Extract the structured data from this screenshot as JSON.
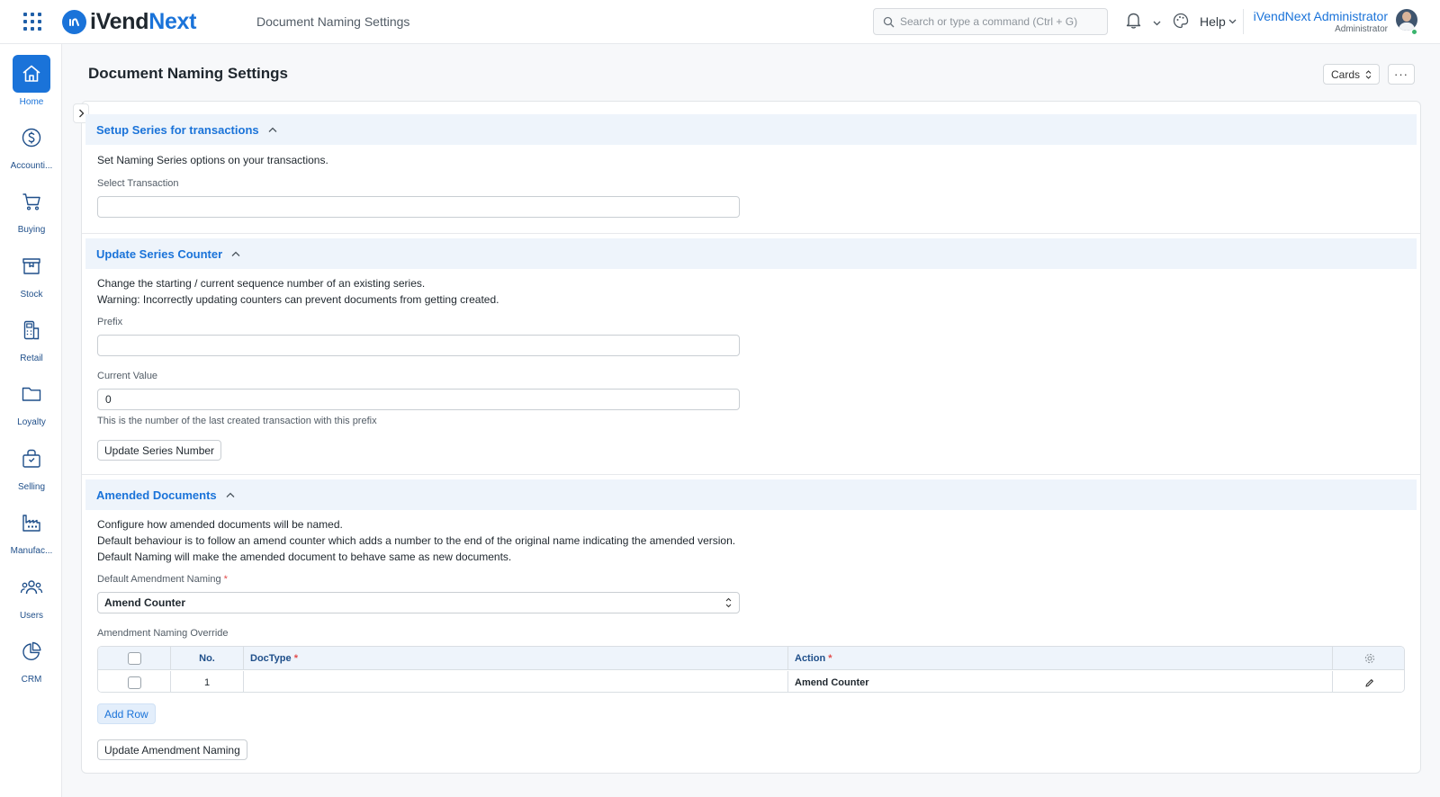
{
  "navbar": {
    "logo_part1": "iVend",
    "logo_part2": "Next",
    "page_name": "Document Naming Settings",
    "search_placeholder": "Search or type a command (Ctrl + G)",
    "help_label": "Help",
    "user_full_name": "iVendNext Administrator",
    "user_role": "Administrator"
  },
  "sidebar": {
    "items": [
      {
        "label": "Home",
        "icon": "home-icon",
        "active": true
      },
      {
        "label": "Accounti...",
        "icon": "dollar-icon"
      },
      {
        "label": "Buying",
        "icon": "cart-icon"
      },
      {
        "label": "Stock",
        "icon": "box-icon"
      },
      {
        "label": "Retail",
        "icon": "pos-icon"
      },
      {
        "label": "Loyalty",
        "icon": "folder-icon"
      },
      {
        "label": "Selling",
        "icon": "bag-icon"
      },
      {
        "label": "Manufac...",
        "icon": "factory-icon"
      },
      {
        "label": "Users",
        "icon": "users-icon"
      },
      {
        "label": "CRM",
        "icon": "chart-pie-icon"
      }
    ]
  },
  "page": {
    "title": "Document Naming Settings",
    "view_button": "Cards",
    "more_button": "···"
  },
  "setup_series": {
    "heading": "Setup Series for transactions",
    "description": "Set Naming Series options on your transactions.",
    "select_transaction_label": "Select Transaction",
    "select_transaction_value": ""
  },
  "update_counter": {
    "heading": "Update Series Counter",
    "description_line1": "Change the starting / current sequence number of an existing series.",
    "description_line2": "Warning: Incorrectly updating counters can prevent documents from getting created.",
    "prefix_label": "Prefix",
    "prefix_value": "",
    "current_value_label": "Current Value",
    "current_value": "0",
    "current_value_help": "This is the number of the last created transaction with this prefix",
    "update_button": "Update Series Number"
  },
  "amended_documents": {
    "heading": "Amended Documents",
    "description_line1": "Configure how amended documents will be named.",
    "description_line2": "Default behaviour is to follow an amend counter which adds a number to the end of the original name indicating the amended version.",
    "description_line3": "Default Naming will make the amended document to behave same as new documents.",
    "default_naming_label": "Default Amendment Naming",
    "default_naming_value": "Amend Counter",
    "override_label": "Amendment Naming Override",
    "table": {
      "columns": {
        "no": "No.",
        "doctype": "DocType",
        "action": "Action"
      },
      "rows": [
        {
          "no": "1",
          "doctype": "",
          "action": "Amend Counter"
        }
      ]
    },
    "add_row_button": "Add Row",
    "update_button": "Update Amendment Naming"
  },
  "colors": {
    "accent": "#1a73d9",
    "section_bg": "#eef4fb",
    "required": "#e24c4c",
    "online": "#3bb46e"
  }
}
